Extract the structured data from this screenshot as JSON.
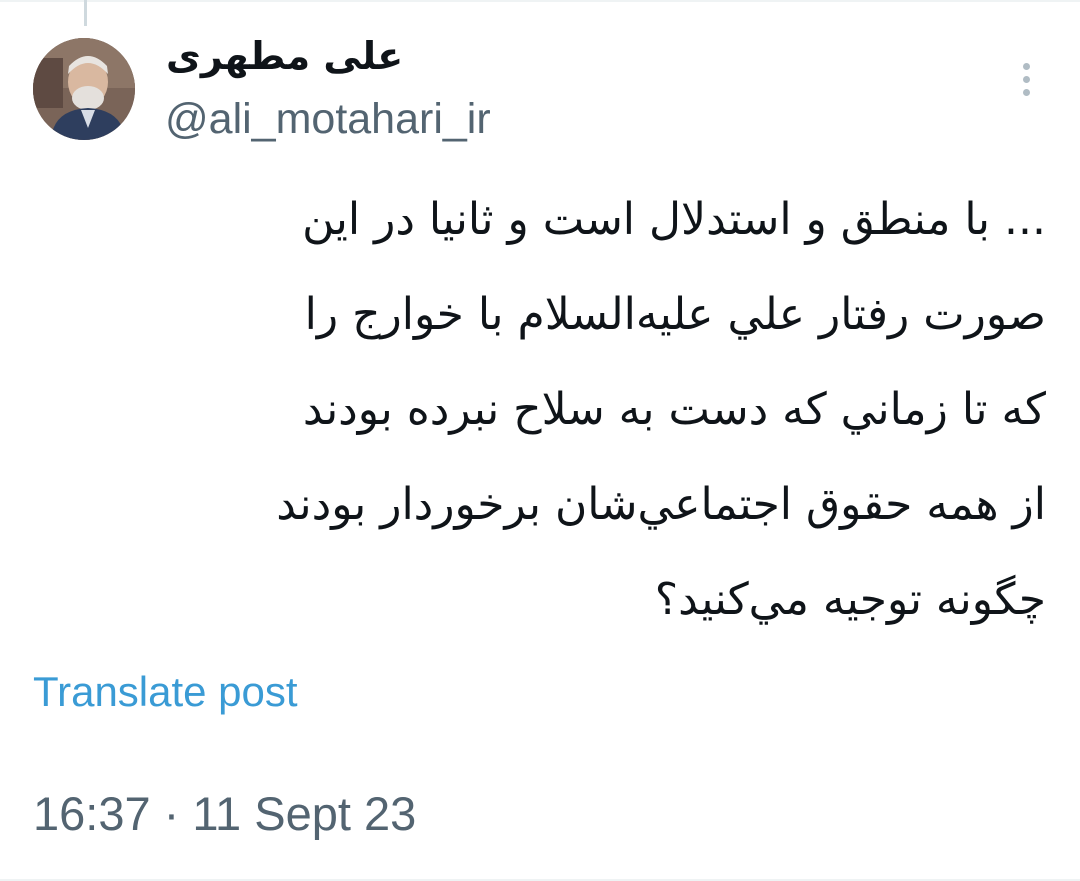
{
  "author": {
    "display_name": "علی مطهری",
    "handle": "@ali_motahari_ir",
    "avatar_icon": "avatar-photo"
  },
  "tweet": {
    "lines": [
      "... با منطق و استدلال است و ثانیا در این",
      "صورت رفتار علي عليه‌السلام با خوارج را",
      "كه تا زماني كه دست به سلاح نبرده بودند",
      "از همه حقوق اجتماعي‌شان برخوردار بودند",
      "چگونه توجيه مي‌كنيد؟"
    ]
  },
  "translate_label": "Translate post",
  "timestamp": "16:37 · 11 Sept 23",
  "more_icon": "more-options-icon",
  "colors": {
    "link": "#3a9bd5",
    "secondary_text": "#536471",
    "primary_text": "#0f1419"
  }
}
